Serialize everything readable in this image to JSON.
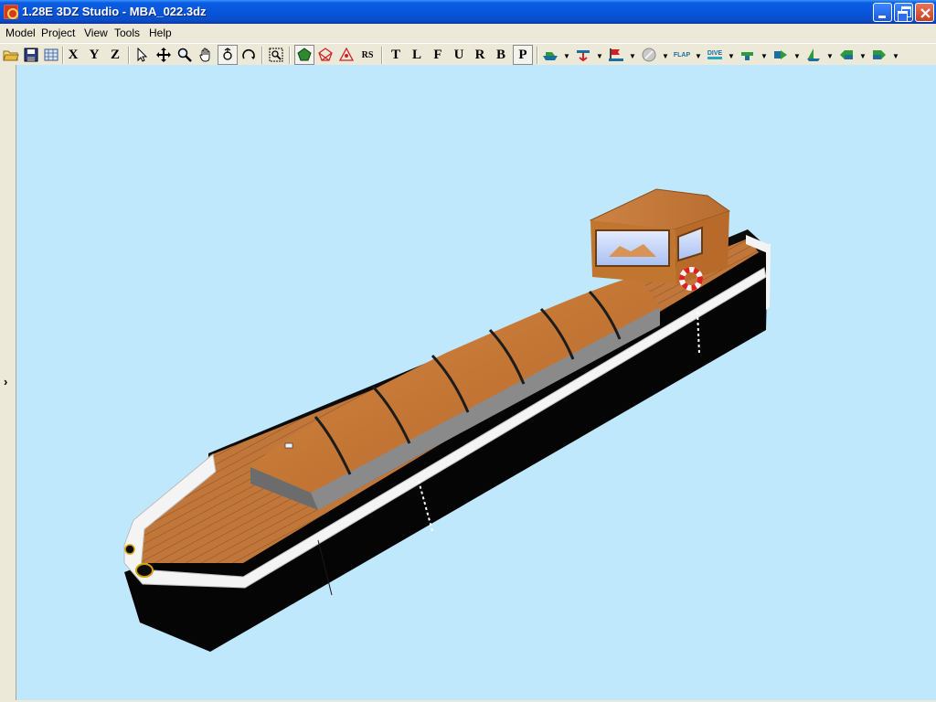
{
  "window": {
    "title": "1.28E 3DZ Studio - MBA_022.3dz"
  },
  "menu": {
    "items": [
      "Model",
      "Project",
      "View",
      "Tools",
      "Help"
    ]
  },
  "toolbar": {
    "letters": [
      "X",
      "Y",
      "Z"
    ],
    "view_letters": [
      "T",
      "L",
      "F",
      "U",
      "R",
      "B",
      "P"
    ],
    "rs_label": "RS",
    "flap_label": "FLAP",
    "dive_label": "DIVE",
    "icons": [
      "open-folder-icon",
      "save-disk-icon",
      "grid-icon",
      "select-arrow-icon",
      "move-cross-icon",
      "zoom-magnifier-icon",
      "pan-hand-icon",
      "rotate-icon",
      "orbit-icon",
      "zoom-extents-icon",
      "solid-shade-icon",
      "wireframe-red-icon",
      "vertex-red-icon"
    ]
  },
  "viewport": {
    "background": "#c0e8fd",
    "model": "barge"
  },
  "left_panel": {
    "expand_glyph": "›"
  },
  "colors": {
    "titlebar": "#0855dd",
    "chrome": "#ece9d8",
    "wood": "#c57a3a",
    "hull": "#050505",
    "gunwale": "#f5f5f5"
  }
}
